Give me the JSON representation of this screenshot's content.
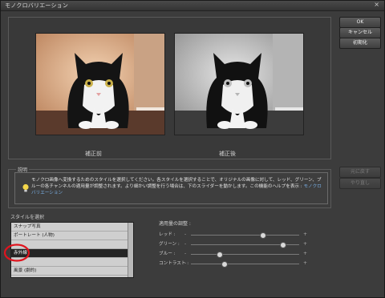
{
  "window": {
    "title": "モノクロバリエーション",
    "close_glyph": "×"
  },
  "preview": {
    "before_label": "補正前",
    "after_label": "補正後"
  },
  "buttons": {
    "ok": "OK",
    "cancel": "キャンセル",
    "reset": "初期化",
    "undo": "元に戻す",
    "redo": "やり直し"
  },
  "description": {
    "legend": "説明",
    "text": "モノクロ画像へ変換するためのスタイルを選択してください。各スタイルを選択することで、オリジナルの画像に対して、レッド、グリーン、ブルーの各チャンネルの適用量が調整されます。より細かい調整を行う場合は、下のスライダーを動かします。この機能のヘルプを表示 :",
    "link": "モノクロバリエーション"
  },
  "style_list": {
    "label": "スタイルを選択",
    "items": [
      "スナップ写真",
      "ポートレート (人物)",
      "",
      "赤外線",
      "",
      "風景 (劇的)"
    ],
    "selected_index": 3
  },
  "adjust": {
    "label": "適用量の調整 :",
    "minus": "-",
    "plus": "+",
    "sliders": [
      {
        "name": "レッド :",
        "value": 0.67
      },
      {
        "name": "グリーン :",
        "value": 0.85
      },
      {
        "name": "ブルー :",
        "value": 0.27
      },
      {
        "name": "コントラスト :",
        "value": 0.31
      }
    ]
  },
  "colors": {
    "highlight_circle": "#e0141e",
    "link": "#7ab1e8"
  }
}
